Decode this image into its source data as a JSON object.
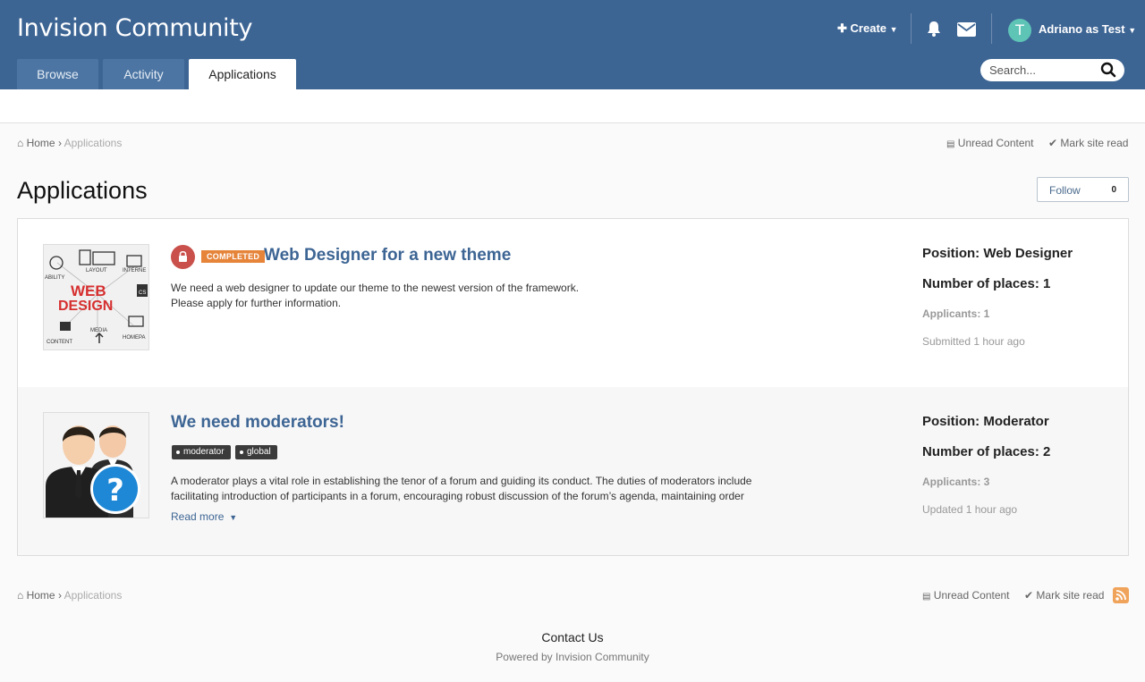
{
  "header": {
    "site_title": "Invision Community",
    "tabs": [
      {
        "label": "Browse"
      },
      {
        "label": "Activity"
      },
      {
        "label": "Applications"
      }
    ],
    "create_label": "Create",
    "avatar_letter": "T",
    "user_label": "Adriano as Test",
    "search_placeholder": "Search..."
  },
  "breadcrumb": {
    "home": "Home",
    "current": "Applications"
  },
  "top_links": {
    "unread": "Unread Content",
    "mark_read": "Mark site read"
  },
  "page": {
    "title": "Applications",
    "follow_label": "Follow",
    "follow_count": "0"
  },
  "items": [
    {
      "status_badge": "COMPLETED",
      "title": "Web Designer for a new theme",
      "desc_line1": "We need a web designer to update our theme to the newest version of the framework.",
      "desc_line2": "Please apply for further information.",
      "position": "Position: Web Designer",
      "places": "Number of places: 1",
      "applicants": "Applicants: 1",
      "time": "Submitted 1 hour ago",
      "thumb_text": {
        "web": "WEB",
        "design": "DESIGN",
        "layout": "LAYOUT",
        "internet": "INTERNE",
        "ability": "ABILITY",
        "content": "CONTENT",
        "media": "MEDIA",
        "homepage": "HOMEPA",
        "css": "CS"
      }
    },
    {
      "title": "We need moderators!",
      "tags": [
        "moderator",
        "global"
      ],
      "desc_line1": "A moderator plays a vital role in establishing the tenor of a forum and guiding its conduct. The duties of moderators include",
      "desc_line2": "facilitating introduction of participants in a forum, encouraging robust discussion of the forum’s agenda, maintaining order",
      "read_more": "Read more",
      "position": "Position: Moderator",
      "places": "Number of places: 2",
      "applicants": "Applicants: 3",
      "time": "Updated 1 hour ago",
      "thumb_glyph": "?"
    }
  ],
  "footer": {
    "contact": "Contact Us",
    "powered": "Powered by Invision Community"
  },
  "colors": {
    "header_bg": "#3d6594",
    "link": "#3d6594",
    "badge_completed": "#e6843a",
    "lock": "#c9504b",
    "avatar": "#5ec4b6"
  }
}
